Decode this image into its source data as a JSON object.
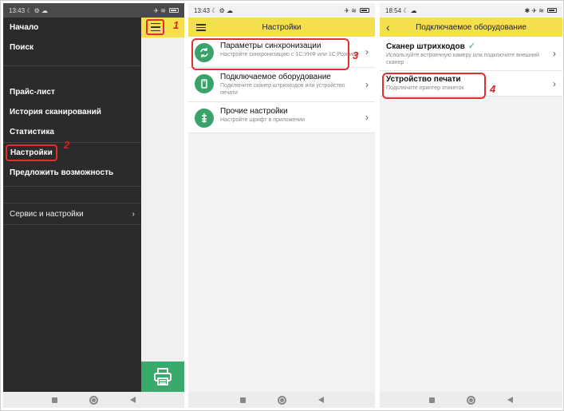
{
  "colors": {
    "accent_yellow": "#f4e04d",
    "highlight_red": "#e03030",
    "icon_green": "#3aa36a",
    "drawer_bg": "#2b2b2b"
  },
  "panel1": {
    "status": {
      "time": "13:43",
      "icons": "☾ ⚙ ☁",
      "right": "✈ ≋"
    },
    "drawer_items": [
      "Начало",
      "Поиск",
      "Прайс-лист",
      "История сканирований",
      "Статистика",
      "Настройки",
      "Предложить возможность"
    ],
    "service_item": "Сервис и настройки",
    "callout_1": "1",
    "callout_2": "2",
    "menu_icon": "hamburger-icon",
    "fab_icon": "printer-icon"
  },
  "panel2": {
    "status": {
      "time": "13:43",
      "icons": "☾ ⚙ ☁",
      "right": "✈ ≋"
    },
    "title": "Настройки",
    "rows": [
      {
        "title": "Параметры синхронизации",
        "subtitle": "Настройте синхронизацию с 1С:УНФ или 1С:Розница",
        "icon": "sync-icon"
      },
      {
        "title": "Подключаемое оборудование",
        "subtitle": "Подключите сканер штрихкодов или устройство печати",
        "icon": "barcode-scanner-icon"
      },
      {
        "title": "Прочие настройки",
        "subtitle": "Настройте шрифт в приложении",
        "icon": "settings-sliders-icon"
      }
    ],
    "callout_3": "3"
  },
  "panel3": {
    "status": {
      "time": "18:54",
      "icons": "☾ ☁",
      "right": "✱ ✈ ≋"
    },
    "title": "Подключаемое оборудование",
    "rows": [
      {
        "title": "Сканер штрихкодов",
        "subtitle": "Используйте встроенную камеру или подключите внешний сканер"
      },
      {
        "title": "Устройство печати",
        "subtitle": "Подключите принтер этикеток"
      }
    ],
    "callout_4": "4"
  }
}
